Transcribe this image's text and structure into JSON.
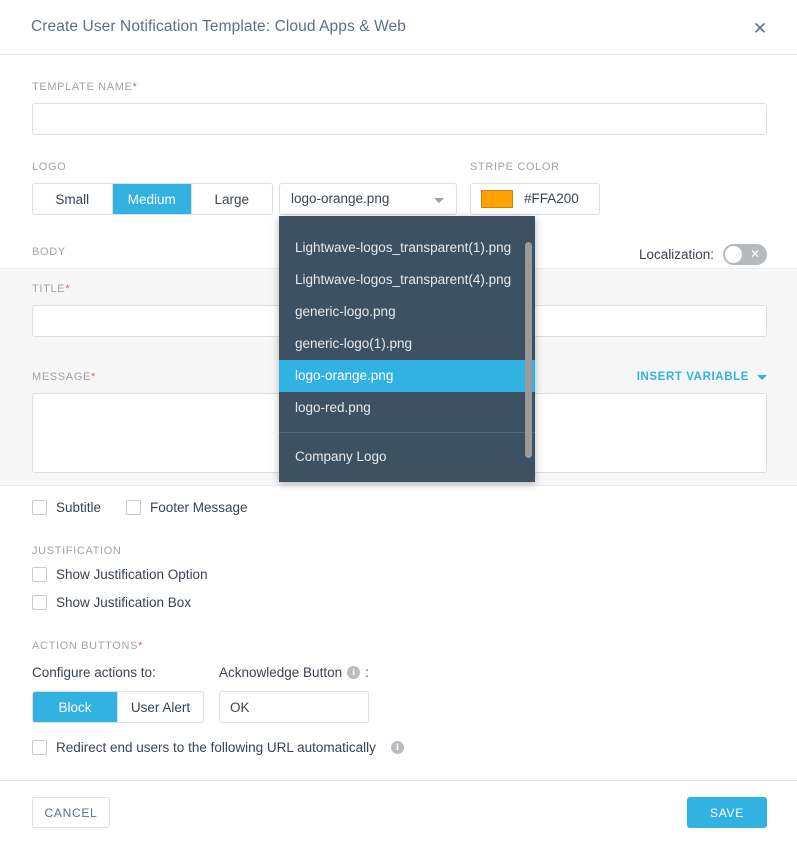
{
  "dialog": {
    "title": "Create User Notification Template: Cloud Apps & Web",
    "close_label": "✕"
  },
  "template_name": {
    "label": "TEMPLATE NAME",
    "required_mark": "*",
    "value": "",
    "placeholder": ""
  },
  "logo": {
    "label": "LOGO",
    "sizes": [
      {
        "label": "Small",
        "active": false
      },
      {
        "label": "Medium",
        "active": true
      },
      {
        "label": "Large",
        "active": false
      }
    ],
    "selected_file": "logo-orange.png",
    "caret_icon": "chevron-down-icon"
  },
  "stripe_color": {
    "label": "STRIPE COLOR",
    "hex": "#FFA200",
    "swatch_color": "#FFA200"
  },
  "logo_dropdown": {
    "open": true,
    "options": [
      {
        "label": "Lightwave-logos_transparent(1).png",
        "selected": false
      },
      {
        "label": "Lightwave-logos_transparent(4).png",
        "selected": false
      },
      {
        "label": "generic-logo.png",
        "selected": false
      },
      {
        "label": "generic-logo(1).png",
        "selected": false
      },
      {
        "label": "logo-orange.png",
        "selected": true
      },
      {
        "label": "logo-red.png",
        "selected": false
      }
    ],
    "footer_option": {
      "label": "Company Logo"
    }
  },
  "body": {
    "label": "BODY",
    "localization": {
      "label": "Localization:",
      "enabled": false,
      "off_glyph": "✕"
    },
    "title_field": {
      "label": "TITLE",
      "required_mark": "*",
      "value": "",
      "placeholder": ""
    },
    "message_field": {
      "label": "MESSAGE",
      "required_mark": "*",
      "value": "",
      "placeholder": ""
    },
    "insert_variable": {
      "label": "INSERT VARIABLE",
      "caret_icon": "chevron-down-icon"
    }
  },
  "options": {
    "subtitle": {
      "label": "Subtitle",
      "checked": false
    },
    "footer_message": {
      "label": "Footer Message",
      "checked": false
    }
  },
  "justification": {
    "label": "JUSTIFICATION",
    "show_option": {
      "label": "Show Justification Option",
      "checked": false
    },
    "show_box": {
      "label": "Show Justification Box",
      "checked": false
    }
  },
  "action_buttons": {
    "label": "ACTION BUTTONS",
    "required_mark": "*",
    "configure_label": "Configure actions to:",
    "modes": [
      {
        "label": "Block",
        "active": true
      },
      {
        "label": "User Alert",
        "active": false
      }
    ],
    "acknowledge": {
      "label": "Acknowledge Button",
      "info_glyph": "i",
      "colon": ":",
      "value": "OK",
      "placeholder": ""
    },
    "redirect": {
      "label": "Redirect end users to the following URL automatically",
      "checked": false,
      "info_glyph": "i"
    }
  },
  "footer": {
    "cancel_label": "CANCEL",
    "save_label": "SAVE"
  },
  "colors": {
    "accent": "#32B2E0",
    "dropdown_bg": "#3E5163",
    "stripe": "#FFA200",
    "required": "#EC5B56",
    "title_text": "#5D7085"
  }
}
